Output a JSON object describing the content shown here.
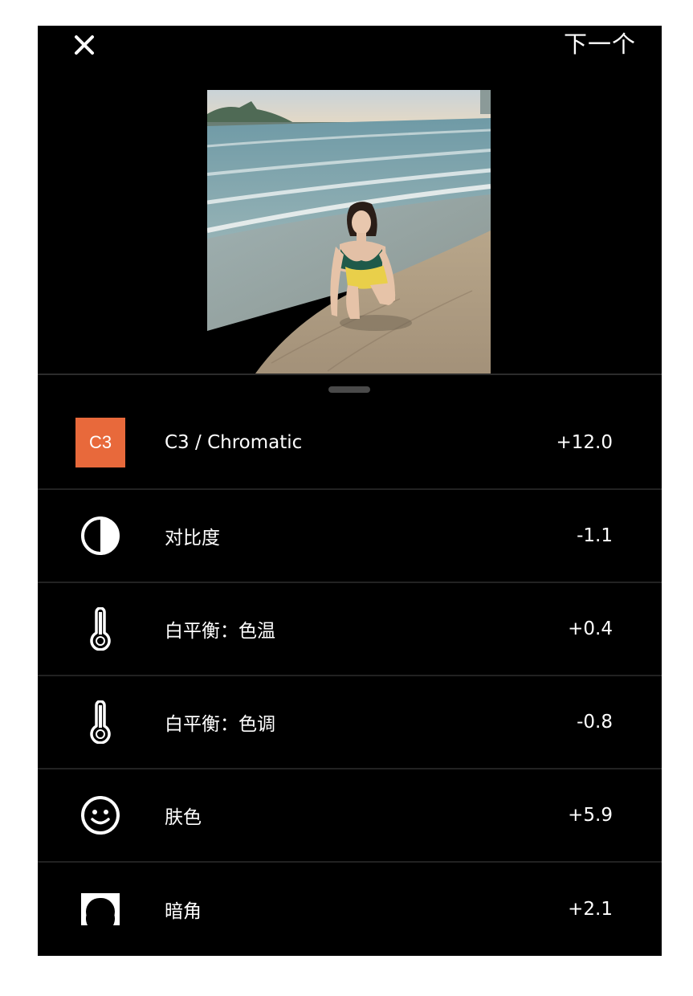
{
  "header": {
    "close_glyph": "✕",
    "next_label": "下一个"
  },
  "photo": {
    "description_icon": "photo-beach-portrait"
  },
  "colors": {
    "background": "#000000",
    "accent": "#e8693b",
    "divider": "#222222"
  },
  "adjustments": [
    {
      "icon": "c3-filter-badge",
      "badge_text": "C3",
      "label": "C3 / Chromatic",
      "value": "+12.0"
    },
    {
      "icon": "contrast-icon",
      "label": "对比度",
      "value": "-1.1"
    },
    {
      "icon": "thermometer-icon",
      "label": "白平衡：色温",
      "value": "+0.4"
    },
    {
      "icon": "thermometer-icon",
      "label": "白平衡：色调",
      "value": "-0.8"
    },
    {
      "icon": "smiley-face-icon",
      "label": "肤色",
      "value": "+5.9"
    },
    {
      "icon": "vignette-icon",
      "label": "暗角",
      "value": "+2.1"
    }
  ]
}
